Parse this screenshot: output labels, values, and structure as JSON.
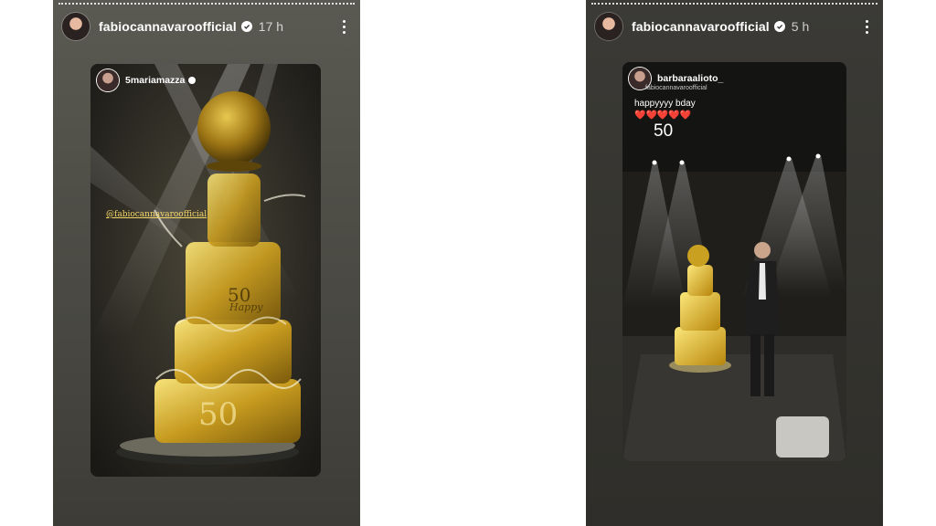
{
  "stories": [
    {
      "username": "fabiocannavaroofficial",
      "time": "17 h",
      "reshared_from": "5mariamazza",
      "mention": "@fabiocannavaroofficial"
    },
    {
      "username": "fabiocannavaroofficial",
      "time": "5 h",
      "reshared_from": "barbaraalioto_",
      "tagged": "fabiocannavaroofficial",
      "caption": "happyyyy bday",
      "hearts": "❤️❤️❤️❤️❤️",
      "number": "50"
    }
  ],
  "icons": [
    "verified-badge-icon",
    "more-options-icon"
  ],
  "colors": {
    "gold": "#d8b23a",
    "verified_check": "#2b2b2b"
  }
}
